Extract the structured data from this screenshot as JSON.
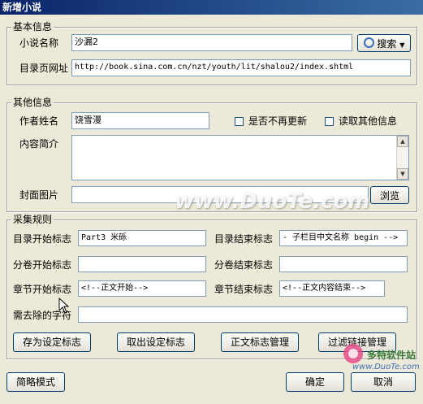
{
  "window": {
    "title": "新增小说"
  },
  "basic": {
    "legend": "基本信息",
    "name_label": "小说名称",
    "name_value": "沙漏2",
    "search_label": "搜索",
    "url_label": "目录页网址",
    "url_value": "http://book.sina.com.cn/nzt/youth/lit/shalou2/index.shtml"
  },
  "other": {
    "legend": "其他信息",
    "author_label": "作者姓名",
    "author_value": "饶雪漫",
    "no_update_label": "是否不再更新",
    "read_other_label": "读取其他信息",
    "intro_label": "内容简介",
    "cover_label": "封面图片",
    "browse_label": "浏览"
  },
  "rules": {
    "legend": "采集规则",
    "toc_start_label": "目录开始标志",
    "toc_start_value": "Part3 米砾",
    "toc_end_label": "目录结束标志",
    "toc_end_value": "- 子栏目中文名称 begin -->",
    "vol_start_label": "分卷开始标志",
    "vol_end_label": "分卷结束标志",
    "chap_start_label": "章节开始标志",
    "chap_start_value": "<!--正文开始-->",
    "chap_end_label": "章节结束标志",
    "chap_end_value": "<!--正文内容结束-->",
    "remove_label": "需去除的字符",
    "btn_save": "存为设定标志",
    "btn_load": "取出设定标志",
    "btn_manage": "正文标志管理",
    "btn_filter": "过滤链接管理"
  },
  "footer": {
    "simple_mode": "简略模式",
    "ok": "确定",
    "cancel": "取消"
  },
  "watermark": {
    "text": "www.DuoTe.com",
    "logo_text": "多特软件站",
    "logo_url": "www.DuoTe.com"
  }
}
